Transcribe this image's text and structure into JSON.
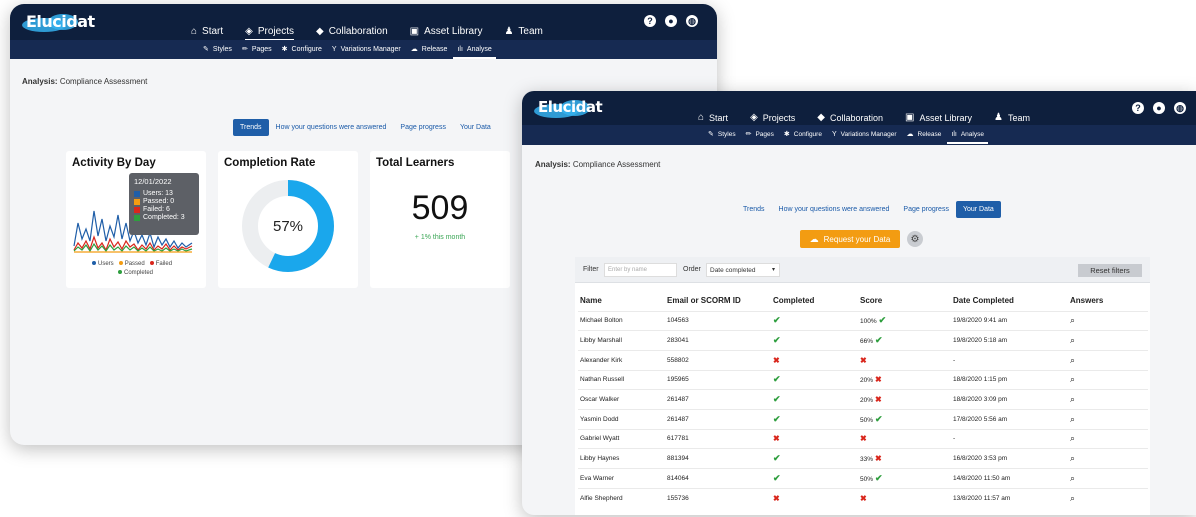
{
  "app": {
    "logo": "Elucidat",
    "nav": [
      "Start",
      "Projects",
      "Collaboration",
      "Asset Library",
      "Team"
    ],
    "nav_icons": [
      "home-icon",
      "layers-icon",
      "handshake-icon",
      "images-icon",
      "team-icon"
    ],
    "subnav": [
      "Styles",
      "Pages",
      "Configure",
      "Variations Manager",
      "Release",
      "Analyse"
    ],
    "subnav_icons": [
      "brush-icon",
      "pencil-icon",
      "gear-icon",
      "branch-icon",
      "cloud-icon",
      "bars-icon"
    ],
    "utility_icons": [
      "help-icon",
      "user-icon",
      "globe-icon"
    ]
  },
  "breadcrumb": {
    "label": "Analysis:",
    "value": "Compliance Assessment"
  },
  "tabs": [
    "Trends",
    "How your questions were answered",
    "Page progress",
    "Your Data"
  ],
  "cards": {
    "activity": {
      "title": "Activity By Day",
      "tooltip": {
        "date": "12/01/2022",
        "rows": [
          {
            "label": "Users: 13",
            "color": "#1f5ea8"
          },
          {
            "label": "Passed: 0",
            "color": "#f39c12"
          },
          {
            "label": "Failed: 6",
            "color": "#d9261c"
          },
          {
            "label": "Completed: 3",
            "color": "#2e9e3e"
          }
        ]
      },
      "legend": [
        "Users",
        "Passed",
        "Failed",
        "Completed"
      ]
    },
    "completion": {
      "title": "Completion Rate",
      "percent_label": "57%",
      "value": 57
    },
    "learners": {
      "title": "Total Learners",
      "count": "509",
      "growth": "+ 1% this month"
    }
  },
  "data_view": {
    "request_button": "Request your Data",
    "filter_label": "Filter",
    "filter_placeholder": "Enter by name",
    "order_label": "Order",
    "order_value": "Date completed",
    "reset_label": "Reset filters",
    "columns": [
      "Name",
      "Email or SCORM ID",
      "Completed",
      "Score",
      "Date Completed",
      "Answers"
    ],
    "rows": [
      {
        "name": "Michael Bolton",
        "id": "104563",
        "completed": true,
        "score": "100%",
        "passed": true,
        "date": "19/8/2020 9:41 am"
      },
      {
        "name": "Libby Marshall",
        "id": "283041",
        "completed": true,
        "score": "66%",
        "passed": true,
        "date": "19/8/2020 5:18 am"
      },
      {
        "name": "Alexander Kirk",
        "id": "558802",
        "completed": false,
        "score": "",
        "passed": false,
        "date": "-"
      },
      {
        "name": "Nathan Russell",
        "id": "195965",
        "completed": true,
        "score": "20%",
        "passed": false,
        "date": "18/8/2020 1:15 pm"
      },
      {
        "name": "Oscar Walker",
        "id": "261487",
        "completed": true,
        "score": "20%",
        "passed": false,
        "date": "18/8/2020 3:09 pm"
      },
      {
        "name": "Yasmin Dodd",
        "id": "261487",
        "completed": true,
        "score": "50%",
        "passed": true,
        "date": "17/8/2020 5:56 am"
      },
      {
        "name": "Gabriel Wyatt",
        "id": "617781",
        "completed": false,
        "score": "",
        "passed": false,
        "date": "-"
      },
      {
        "name": "Libby Haynes",
        "id": "881394",
        "completed": true,
        "score": "33%",
        "passed": false,
        "date": "16/8/2020 3:53 pm"
      },
      {
        "name": "Eva Warner",
        "id": "814064",
        "completed": true,
        "score": "50%",
        "passed": true,
        "date": "14/8/2020 11:50 am"
      },
      {
        "name": "Alfie Shepherd",
        "id": "155736",
        "completed": false,
        "score": "",
        "passed": false,
        "date": "13/8/2020 11:57 am"
      }
    ]
  },
  "colors": {
    "navy": "#0e1f3d",
    "subnav": "#162a52",
    "accent": "#1f5ea8",
    "donut": "#1aa7ec",
    "orange": "#f39c12"
  }
}
